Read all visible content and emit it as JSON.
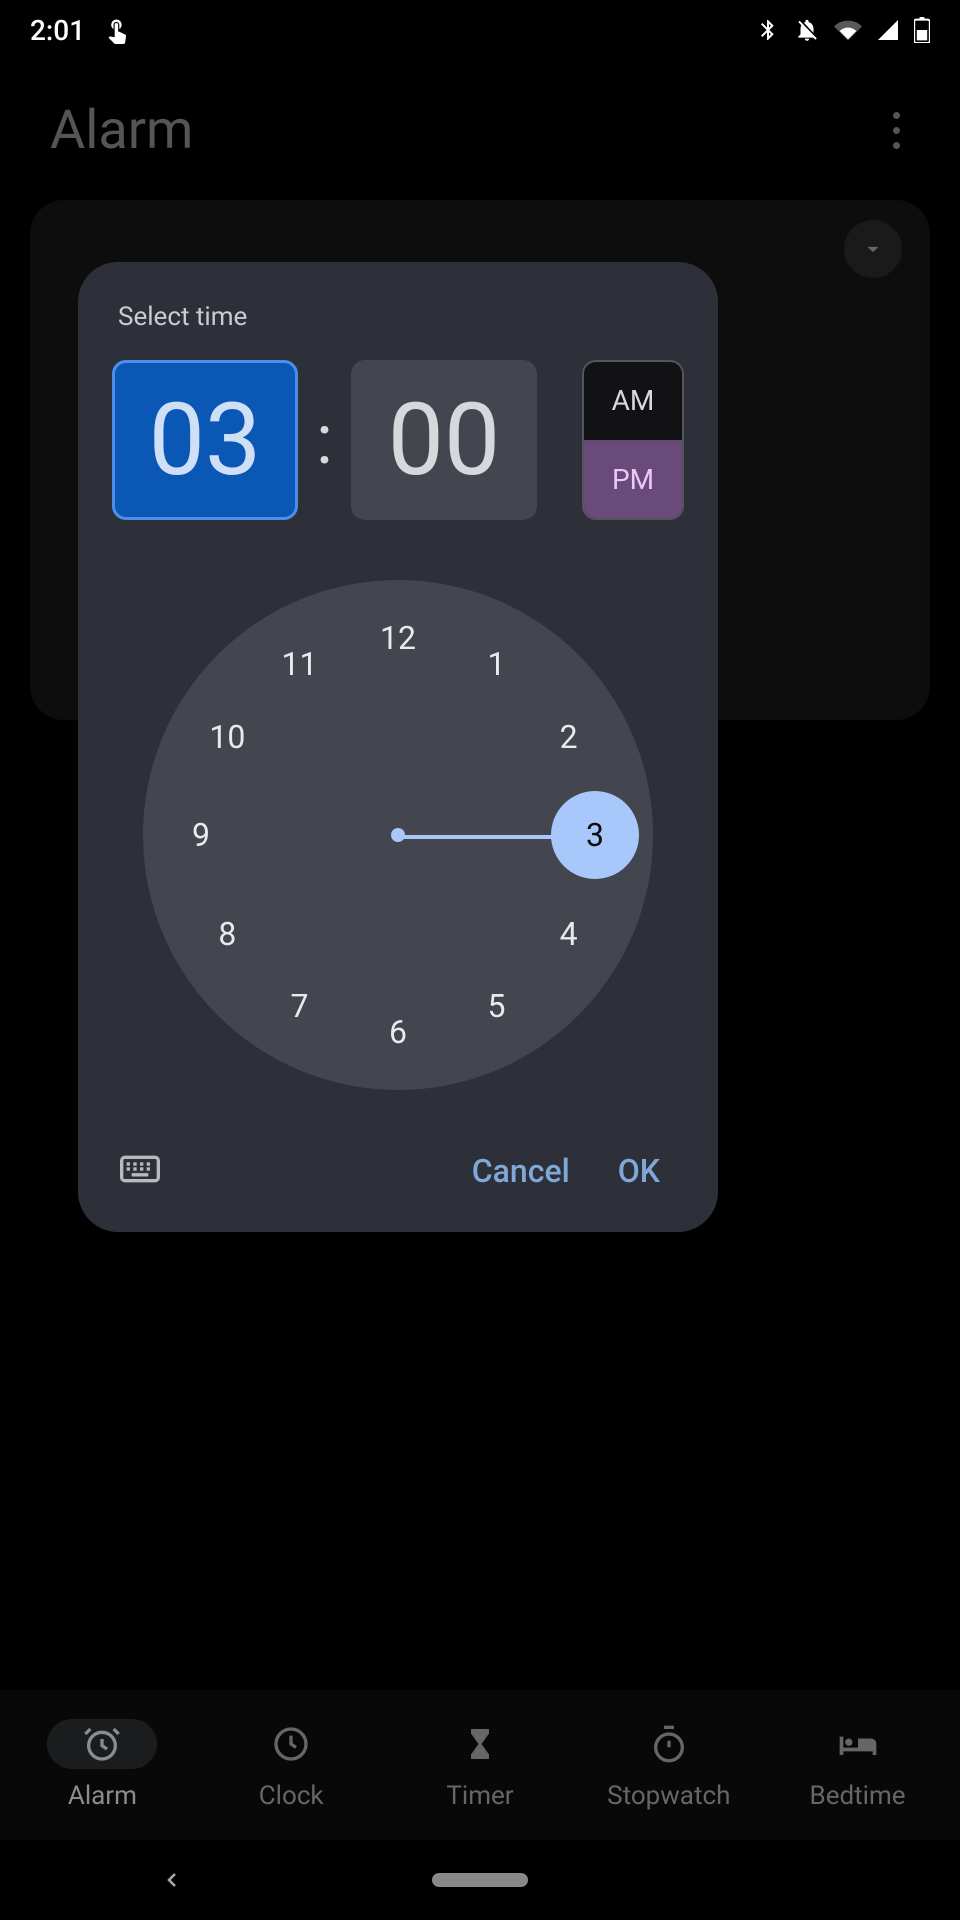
{
  "status": {
    "time": "2:01"
  },
  "header": {
    "title": "Alarm"
  },
  "dialog": {
    "title": "Select time",
    "hour": "03",
    "minute": "00",
    "am": "AM",
    "pm": "PM",
    "selected_hour": "3",
    "cancel": "Cancel",
    "ok": "OK",
    "clock_numbers": [
      "12",
      "1",
      "2",
      "3",
      "4",
      "5",
      "6",
      "7",
      "8",
      "9",
      "10",
      "11"
    ]
  },
  "nav": {
    "items": [
      {
        "label": "Alarm",
        "icon": "alarm"
      },
      {
        "label": "Clock",
        "icon": "clock"
      },
      {
        "label": "Timer",
        "icon": "timer"
      },
      {
        "label": "Stopwatch",
        "icon": "stopwatch"
      },
      {
        "label": "Bedtime",
        "icon": "bedtime"
      }
    ]
  }
}
